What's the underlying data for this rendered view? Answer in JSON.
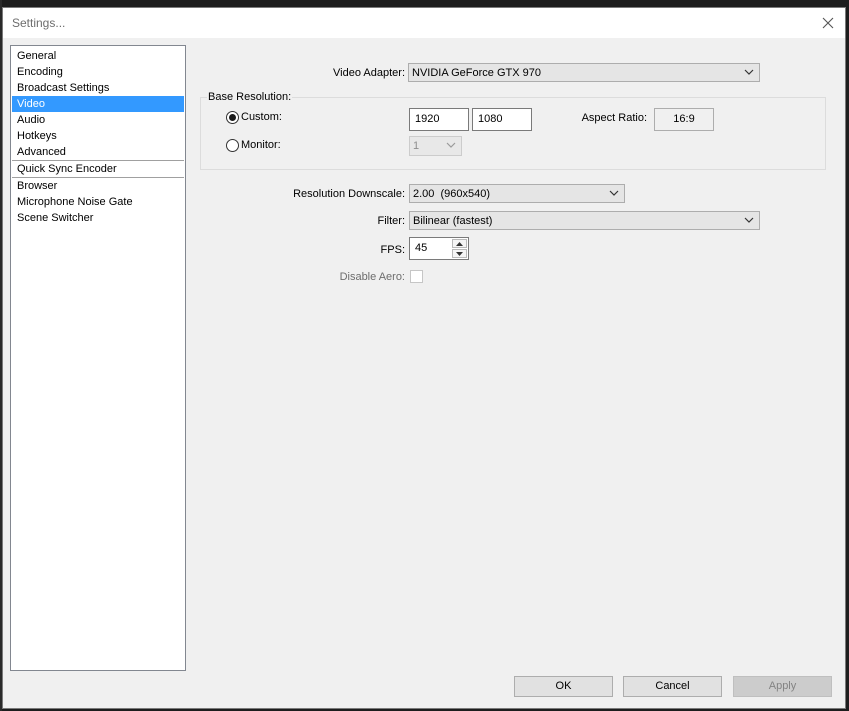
{
  "window": {
    "title": "Settings..."
  },
  "nav": {
    "groups": [
      [
        "General",
        "Encoding",
        "Broadcast Settings",
        "Video",
        "Audio",
        "Hotkeys",
        "Advanced"
      ],
      [
        "Quick Sync Encoder"
      ],
      [
        "Browser",
        "Microphone Noise Gate",
        "Scene Switcher"
      ]
    ],
    "selected": "Video"
  },
  "video": {
    "adapter_label": "Video Adapter:",
    "adapter_value": "NVIDIA GeForce GTX 970",
    "base_resolution_label": "Base Resolution:",
    "custom_label": "Custom:",
    "custom_selected": true,
    "width_value": "1920",
    "height_value": "1080",
    "aspect_label": "Aspect Ratio:",
    "aspect_value": "16:9",
    "monitor_label": "Monitor:",
    "monitor_value": "1",
    "downscale_label": "Resolution Downscale:",
    "downscale_value": "2.00  (960x540)",
    "filter_label": "Filter:",
    "filter_value": "Bilinear (fastest)",
    "fps_label": "FPS:",
    "fps_value": "45",
    "disable_aero_label": "Disable Aero:",
    "disable_aero_checked": false
  },
  "buttons": {
    "ok": "OK",
    "cancel": "Cancel",
    "apply": "Apply"
  },
  "colors": {
    "selection": "#3399ff",
    "dialog_bg": "#f0f0f0"
  }
}
